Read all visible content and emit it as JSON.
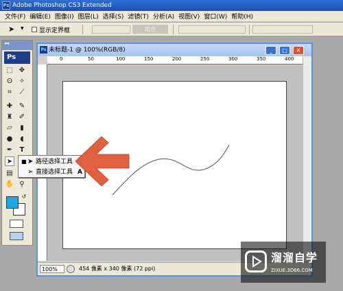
{
  "app": {
    "title": "Adobe Photoshop CS3 Extended",
    "logo": "Ps"
  },
  "menu": [
    "文件(F)",
    "编辑(E)",
    "图像(I)",
    "图层(L)",
    "选择(S)",
    "滤镜(T)",
    "分析(A)",
    "视图(V)",
    "窗口(W)",
    "帮助(H)"
  ],
  "options": {
    "show_bounding_box": "显示定界框",
    "combine_label": "组合"
  },
  "toolbox": {
    "logo": "Ps",
    "header": "◂◂"
  },
  "document": {
    "title": "未标题-1 @ 100%(RGB/8)",
    "zoom": "100%",
    "status": "454 像素 x 340 像素 (72 ppi)",
    "ruler_labels": [
      "0",
      "50",
      "100",
      "150",
      "200",
      "250",
      "300",
      "350",
      "400"
    ]
  },
  "flyout": {
    "items": [
      {
        "label": "路径选择工具",
        "key": "A",
        "selected": true
      },
      {
        "label": "直接选择工具",
        "key": "A",
        "selected": false
      }
    ]
  },
  "colors": {
    "foreground": "#1ba8e8",
    "background": "#ffffff",
    "arrow": "#e0603f"
  },
  "watermark": {
    "brand": "溜溜自学",
    "url": "ZIXUE.3D66.COM"
  }
}
